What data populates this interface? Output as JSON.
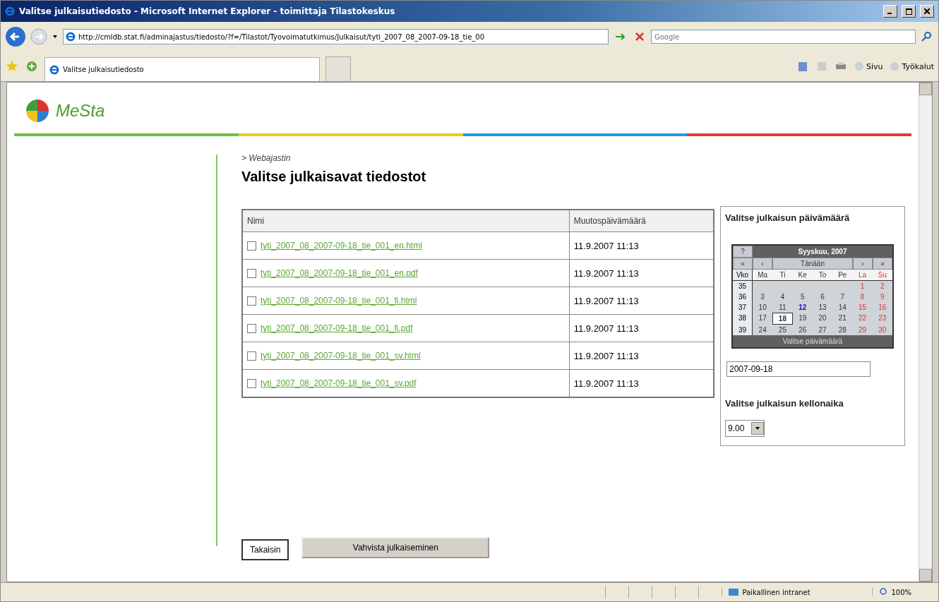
{
  "window": {
    "title": "Valitse julkaisutiedosto - Microsoft Internet Explorer - toimittaja Tilastokeskus"
  },
  "address_bar": {
    "url": "http://cmldb.stat.fi/adminajastus/tiedosto/?f=/Tilastot/Tyovoimatutkimus/Julkaisut/tyti_2007_08_2007-09-18_tie_00",
    "search_placeholder": "Google"
  },
  "tab": {
    "label": "Valitse julkaisutiedosto"
  },
  "toolbar": {
    "items": [
      "Sivu",
      "Työkalut"
    ]
  },
  "logo": {
    "text": "MeSta"
  },
  "breadcrumb": "> Webajastin",
  "heading": "Valitse julkaisavat tiedostot",
  "table": {
    "columns": [
      "Nimi",
      "Muutospäivämäärä"
    ],
    "rows": [
      {
        "name": "tyti_2007_08_2007-09-18_tie_001_en.html",
        "date": "11.9.2007 11:13",
        "checked": false
      },
      {
        "name": "tyti_2007_08_2007-09-18_tie_001_en.pdf",
        "date": "11.9.2007 11:13",
        "checked": false
      },
      {
        "name": "tyti_2007_08_2007-09-18_tie_001_fi.html",
        "date": "11.9.2007 11:13",
        "checked": false
      },
      {
        "name": "tyti_2007_08_2007-09-18_tie_001_fi.pdf",
        "date": "11.9.2007 11:13",
        "checked": false
      },
      {
        "name": "tyti_2007_08_2007-09-18_tie_001_sv.html",
        "date": "11.9.2007 11:13",
        "checked": false
      },
      {
        "name": "tyti_2007_08_2007-09-18_tie_001_sv.pdf",
        "date": "11.9.2007 11:13",
        "checked": false
      }
    ]
  },
  "date_panel": {
    "title": "Valitse julkaisun päivämäärä",
    "date_value": "2007-09-18",
    "time_title": "Valitse julkaisun kellonaika",
    "time_value": "9.00"
  },
  "calendar": {
    "help": "?",
    "month": "Syyskuu, 2007",
    "nav": [
      "«",
      "‹",
      "Tänään",
      "›",
      "»"
    ],
    "week_header": "Vko",
    "weekdays": [
      {
        "label": "Ma",
        "kind": "weekday"
      },
      {
        "label": "Ti",
        "kind": "weekday"
      },
      {
        "label": "Ke",
        "kind": "weekday"
      },
      {
        "label": "To",
        "kind": "weekday"
      },
      {
        "label": "Pe",
        "kind": "weekday"
      },
      {
        "label": "La",
        "kind": "weekend"
      },
      {
        "label": "Su",
        "kind": "weekend"
      }
    ],
    "weeks": [
      {
        "week": "35",
        "days": [
          {
            "d": "1",
            "kind": "weekend",
            "selected": false
          },
          {
            "d": "2",
            "kind": "weekend",
            "selected": false
          }
        ]
      },
      {
        "week": "36",
        "days": [
          {
            "d": "3",
            "kind": "weekday",
            "selected": false
          },
          {
            "d": "4",
            "kind": "weekday",
            "selected": false
          },
          {
            "d": "5",
            "kind": "weekday",
            "selected": false
          },
          {
            "d": "6",
            "kind": "weekday",
            "selected": false
          },
          {
            "d": "7",
            "kind": "weekday",
            "selected": false
          },
          {
            "d": "8",
            "kind": "weekend",
            "selected": false
          },
          {
            "d": "9",
            "kind": "weekend",
            "selected": false
          }
        ]
      },
      {
        "week": "37",
        "days": [
          {
            "d": "10",
            "kind": "weekday",
            "selected": false
          },
          {
            "d": "11",
            "kind": "weekday",
            "selected": false
          },
          {
            "d": "12",
            "kind": "today",
            "selected": false
          },
          {
            "d": "13",
            "kind": "weekday",
            "selected": false
          },
          {
            "d": "14",
            "kind": "weekday",
            "selected": false
          },
          {
            "d": "15",
            "kind": "weekend",
            "selected": false
          },
          {
            "d": "16",
            "kind": "weekend",
            "selected": false
          }
        ]
      },
      {
        "week": "38",
        "days": [
          {
            "d": "17",
            "kind": "weekday",
            "selected": false
          },
          {
            "d": "18",
            "kind": "weekday",
            "selected": true
          },
          {
            "d": "19",
            "kind": "weekday",
            "selected": false
          },
          {
            "d": "20",
            "kind": "weekday",
            "selected": false
          },
          {
            "d": "21",
            "kind": "weekday",
            "selected": false
          },
          {
            "d": "22",
            "kind": "weekend",
            "selected": false
          },
          {
            "d": "23",
            "kind": "weekend",
            "selected": false
          }
        ]
      },
      {
        "week": "39",
        "days": [
          {
            "d": "24",
            "kind": "weekday",
            "selected": false
          },
          {
            "d": "25",
            "kind": "weekday",
            "selected": false
          },
          {
            "d": "26",
            "kind": "weekday",
            "selected": false
          },
          {
            "d": "27",
            "kind": "weekday",
            "selected": false
          },
          {
            "d": "28",
            "kind": "weekday",
            "selected": false
          },
          {
            "d": "29",
            "kind": "weekend",
            "selected": false
          },
          {
            "d": "30",
            "kind": "weekend",
            "selected": false
          }
        ]
      }
    ],
    "footer": "Valitse päivämäärä"
  },
  "buttons": [
    "Takaisin",
    "Vahvista julkaiseminen"
  ],
  "status_bar": {
    "zone": "Paikallinen intranet",
    "zoom": "100%"
  }
}
